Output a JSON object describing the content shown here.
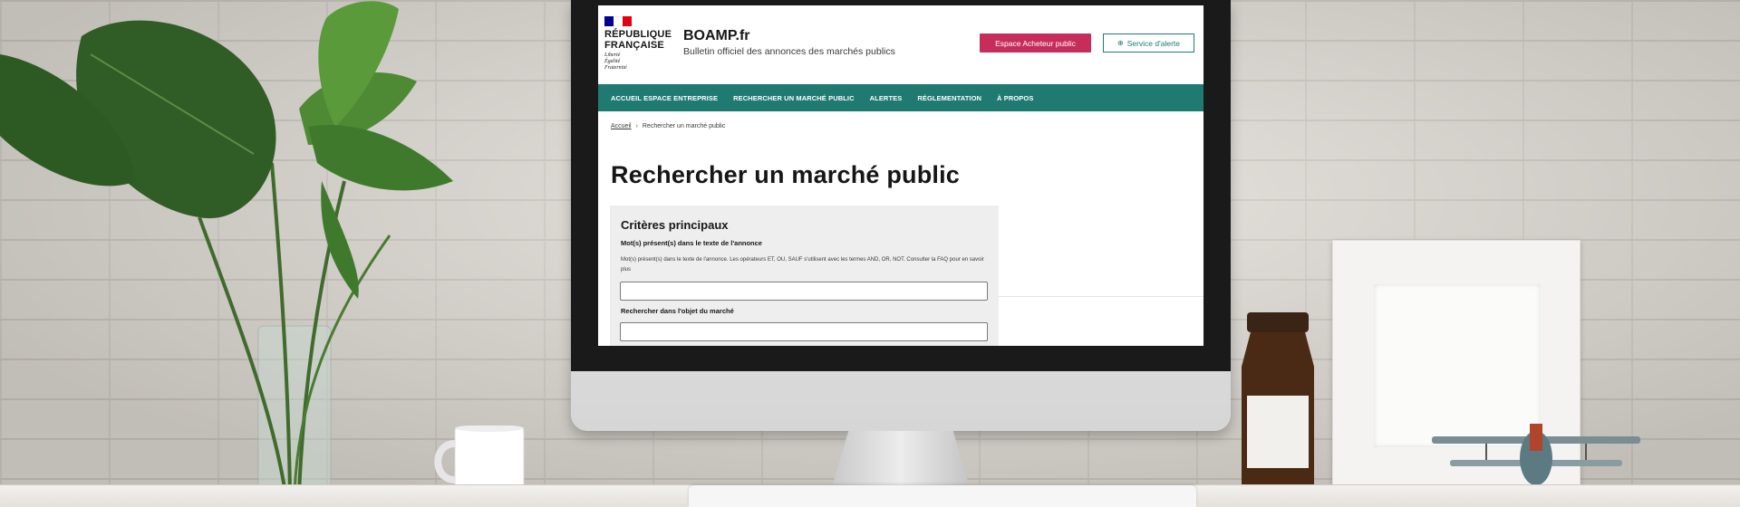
{
  "site": {
    "republique_name": "RÉPUBLIQUE\nFRANÇAISE",
    "republique_motto": "Liberté\nÉgalité\nFraternité",
    "title": "BOAMP.fr",
    "tagline": "Bulletin officiel des annonces des marchés publics"
  },
  "header_buttons": {
    "acheteur_label": "Espace Acheteur public",
    "alerte_label": "Service d'alerte",
    "alerte_icon": "bell-icon"
  },
  "nav": {
    "items": [
      {
        "label": "ACCUEIL ESPACE ENTREPRISE"
      },
      {
        "label": "RECHERCHER UN MARCHÉ PUBLIC"
      },
      {
        "label": "ALERTES"
      },
      {
        "label": "RÉGLEMENTATION"
      },
      {
        "label": "À PROPOS"
      }
    ]
  },
  "breadcrumb": {
    "home": "Accueil",
    "separator": "›",
    "current": "Rechercher un marché public"
  },
  "page": {
    "title": "Rechercher un marché public"
  },
  "criteria": {
    "title": "Critères principaux",
    "keywords_label": "Mot(s) présent(s) dans le texte de l'annonce",
    "keywords_help": "Mot(s) présent(s) dans le texte de l'annonce. Les opérateurs ET, OU, SAUF s'utilisent avec les termes AND, OR, NOT. Consulter la FAQ pour en savoir plus",
    "keywords_value": "",
    "object_label": "Rechercher dans l'objet du marché",
    "object_value": ""
  },
  "colors": {
    "nav_bg": "#1f7a72",
    "acheteur_bg": "#c72d5b",
    "flag_blue": "#000091",
    "flag_red": "#e1000f"
  }
}
